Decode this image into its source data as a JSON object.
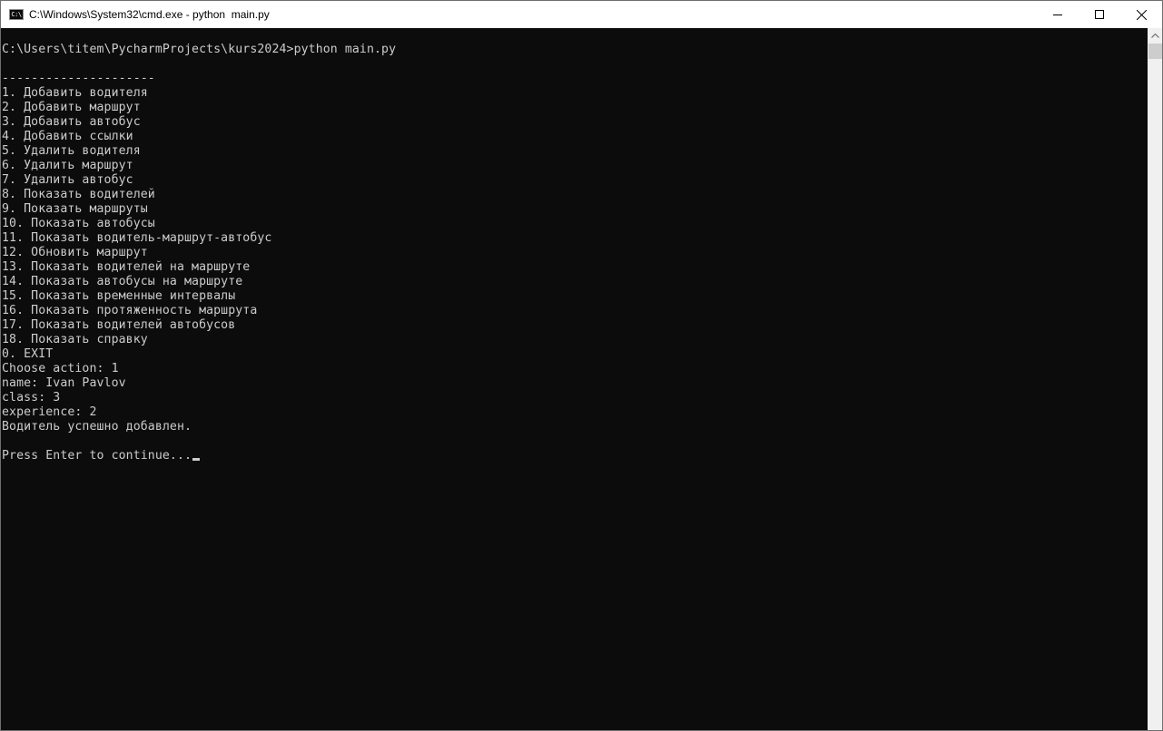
{
  "window": {
    "title": "C:\\Windows\\System32\\cmd.exe - python  main.py",
    "icon": "cmd-icon",
    "icon_glyph": "C:\\",
    "buttons": {
      "minimize": "minimize-icon",
      "maximize": "maximize-icon",
      "close": "close-icon"
    }
  },
  "console": {
    "text_color": "#cccccc",
    "background": "#0c0c0c",
    "lines": [
      "C:\\Users\\titem\\PycharmProjects\\kurs2024>python main.py",
      "",
      "---------------------",
      "1. Добавить водителя",
      "2. Добавить маршрут",
      "3. Добавить автобус",
      "4. Добавить ссылки",
      "5. Удалить водителя",
      "6. Удалить маршрут",
      "7. Удалить автобус",
      "8. Показать водителей",
      "9. Показать маршруты",
      "10. Показать автобусы",
      "11. Показать водитель-маршрут-автобус",
      "12. Обновить маршрут",
      "13. Показать водителей на маршруте",
      "14. Показать автобусы на маршруте",
      "15. Показать временные интервалы",
      "16. Показать протяженность маршрута",
      "17. Показать водителей автобусов",
      "18. Показать справку",
      "0. EXIT",
      "Choose action: 1",
      "name: Ivan Pavlov",
      "class: 3",
      "experience: 2",
      "Водитель успешно добавлен.",
      "",
      "Press Enter to continue..."
    ]
  },
  "scrollbar": {
    "up_arrow": "scroll-up-arrow-icon"
  }
}
